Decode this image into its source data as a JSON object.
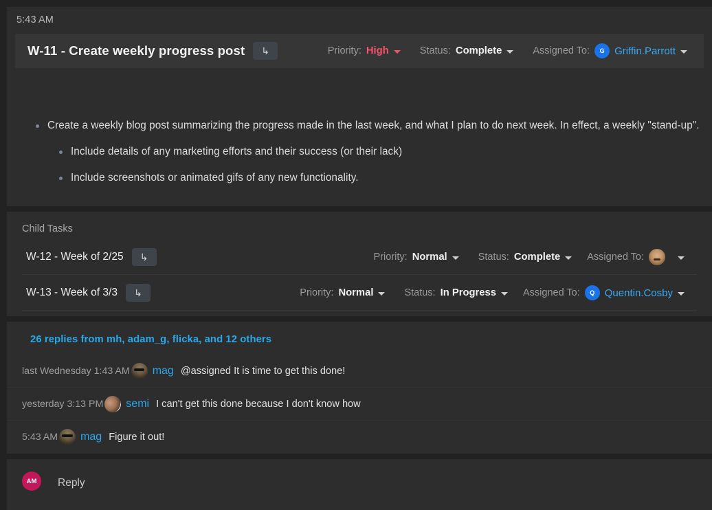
{
  "task": {
    "timestamp": "5:43 AM",
    "title": "W-11 - Create weekly progress post",
    "goto_glyph": "↳",
    "priority_label": "Priority:",
    "priority_value": "High",
    "status_label": "Status:",
    "status_value": "Complete",
    "assigned_label": "Assigned To:",
    "assignee_initial": "G",
    "assignee_name": "Griffin.Parrott",
    "bullets": [
      {
        "level": 1,
        "text": "Create a weekly blog post summarizing the progress made in the last week, and what I plan to do next week. In effect, a weekly \"stand-up\"."
      },
      {
        "level": 2,
        "text": "Include details of any marketing efforts and their success (or their lack)"
      },
      {
        "level": 2,
        "text": "Include screenshots or animated gifs of any new functionality."
      }
    ]
  },
  "child_tasks": {
    "heading": "Child Tasks",
    "rows": [
      {
        "name": "W-12 - Week of 2/25",
        "goto_glyph": "↳",
        "priority_label": "Priority:",
        "priority_value": "Normal",
        "status_label": "Status:",
        "status_value": "Complete",
        "assigned_label": "Assigned To:",
        "assignee_name": ""
      },
      {
        "name": "W-13 - Week of 3/3",
        "goto_glyph": "↳",
        "priority_label": "Priority:",
        "priority_value": "Normal",
        "status_label": "Status:",
        "status_value": "In Progress",
        "assigned_label": "Assigned To:",
        "assignee_initial": "Q",
        "assignee_name": "Quentin.Cosby"
      }
    ]
  },
  "comments": {
    "replies_link": "26 replies from mh, adam_g, flicka, and 12 others",
    "items": [
      {
        "time": "last Wednesday 1:43 AM",
        "user": "mag",
        "body": "@assigned It is time to get this done!"
      },
      {
        "time": "yesterday 3:13 PM",
        "user": "semi",
        "body": "I can't get this done because I don't know how"
      },
      {
        "time": "5:43 AM",
        "user": "mag",
        "body": "Figure it out!"
      }
    ]
  },
  "reply": {
    "avatar_initials": "AM",
    "placeholder": "Reply"
  },
  "colors": {
    "page_bg": "#222222",
    "card_bg": "#2d2d2d",
    "header_bg": "#363636",
    "accent_link": "#2aa8e8",
    "priority_high": "#f4536b",
    "avatar_blue": "#1a73e8",
    "reply_avatar": "#c2185b"
  }
}
